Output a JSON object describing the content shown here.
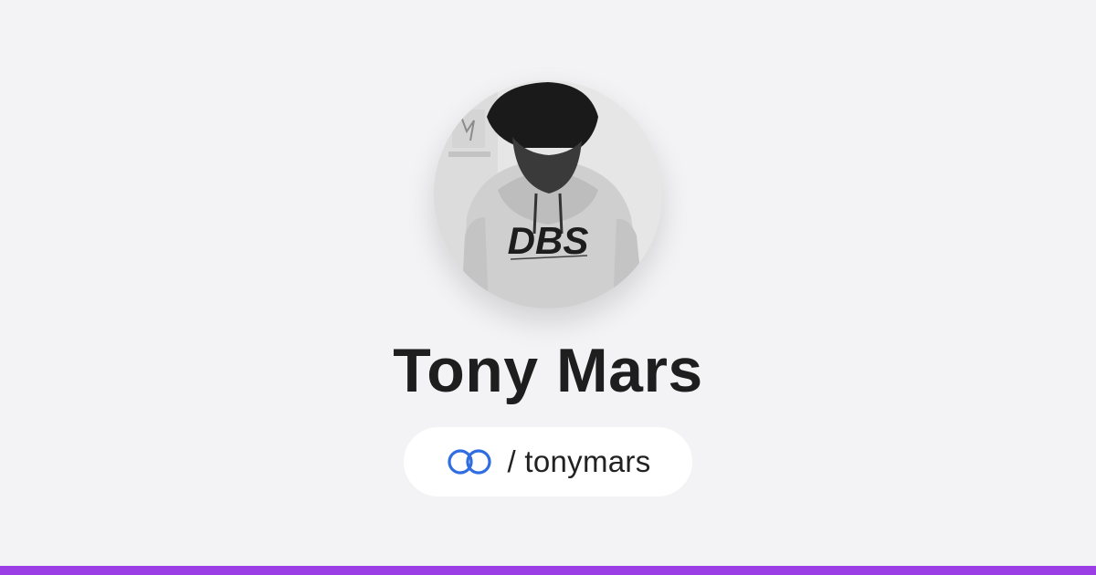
{
  "profile": {
    "name": "Tony Mars",
    "handle": "/ tonymars",
    "avatar_alt": "Tony Mars",
    "hoodie_text": "DBS"
  },
  "icons": {
    "handle_icon": "linked-rings-icon"
  },
  "colors": {
    "background": "#f3f3f6",
    "name_text": "#1e1e1e",
    "pill_background": "#ffffff",
    "ring_color": "#2f6de1",
    "accent_bar": "#9b3ee6"
  }
}
